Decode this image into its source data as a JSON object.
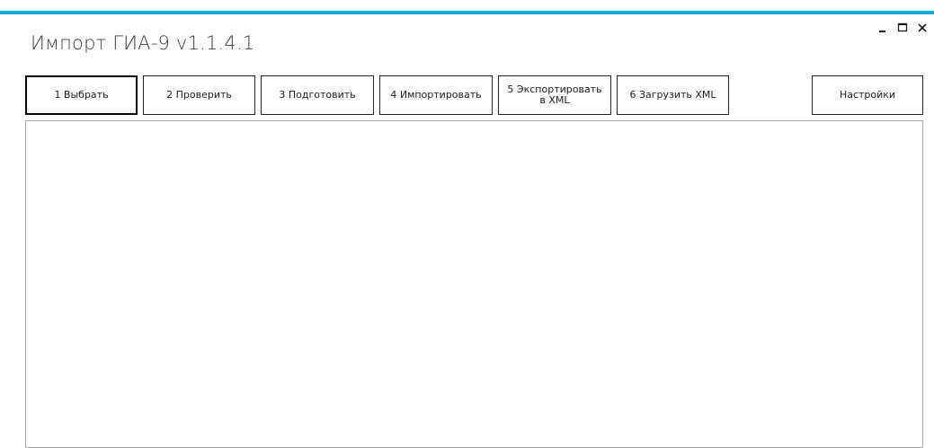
{
  "window": {
    "title": "Импорт ГИА-9 v1.1.4.1",
    "accent_color": "#0fa8d6",
    "controls": {
      "minimize_icon": "minimize-icon",
      "maximize_icon": "maximize-icon",
      "close_icon": "close-icon"
    }
  },
  "toolbar": {
    "select_label": "1   Выбрать",
    "check_label": "2   Проверить",
    "prepare_label": "3  Подготовить",
    "import_label": "4 Импортировать",
    "export_label": "5 Экспортировать\nв XML",
    "load_xml_label": "6 Загрузить XML",
    "settings_label": "Настройки",
    "selected": "1   Выбрать"
  },
  "main": {
    "content": ""
  }
}
